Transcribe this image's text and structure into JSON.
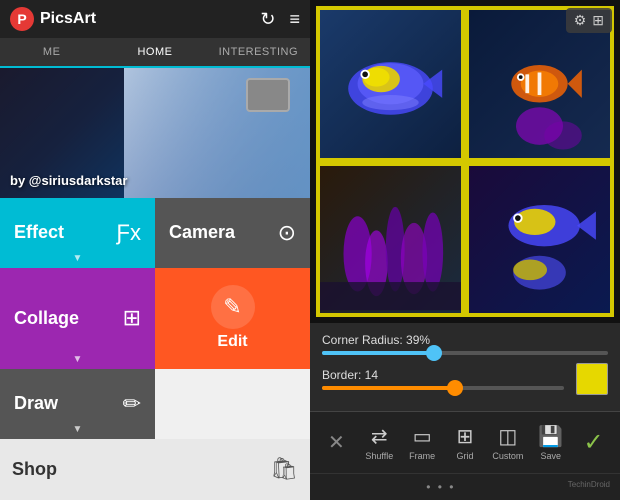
{
  "left": {
    "logo": "PicsArt",
    "nav": {
      "me": "ME",
      "home": "HOME",
      "interesting": "INTERESTING"
    },
    "hero": {
      "byline": "by @siriusdarkstar"
    },
    "menu": {
      "effect": "Effect",
      "camera": "Camera",
      "collage": "Collage",
      "edit": "Edit",
      "draw": "Draw",
      "shop": "Shop"
    }
  },
  "right": {
    "corner_radius_label": "Corner Radius: 39%",
    "border_label": "Border: 14",
    "corner_radius_pct": 39,
    "border_value": 14,
    "toolbar": {
      "shuffle": "Shuffle",
      "frame": "Frame",
      "grid": "Grid",
      "custom": "Custom",
      "save": "Save"
    }
  },
  "watermark": "TechinDroid"
}
